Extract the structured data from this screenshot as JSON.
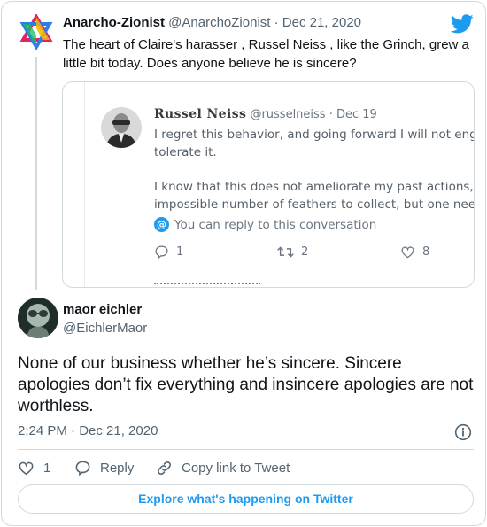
{
  "parent": {
    "name": "Anarcho-Zionist",
    "meta": "@AnarchoZionist · Dec 21, 2020",
    "text": "The heart of Claire's harasser , Russel Neiss , like the Grinch, grew a little bit today.   Does anyone believe he is sincere?"
  },
  "embed": {
    "name": "Russel Neiss",
    "meta": "@russelneiss · Dec 19",
    "line1": "I regret this behavior, and going forward I will not eng",
    "line2": "tolerate it.",
    "line3": "I know that this does not ameliorate my past actions, a",
    "line4": "impossible number of feathers to collect, but one nee",
    "reply_note": "You can reply to this conversation",
    "reply_count": "1",
    "retweet_count": "2",
    "like_count": "8"
  },
  "tweet": {
    "name": "maor eichler",
    "handle": "@EichlerMaor",
    "text": "None of our business whether he’s sincere. Sincere apologies don’t fix everything and insincere apologies are not worthless.",
    "timestamp": "2:24 PM · Dec 21, 2020",
    "like_count": "1",
    "reply_label": "Reply",
    "copy_link_label": "Copy link to Tweet",
    "explore_label": "Explore what's happening on Twitter"
  },
  "colors": {
    "accent": "#1d9bf0",
    "border": "#cfd9de",
    "secondary_text": "#536471"
  },
  "icons": [
    "twitter-bird-icon",
    "info-icon",
    "heart-icon",
    "reply-icon",
    "link-icon",
    "retweet-icon"
  ]
}
